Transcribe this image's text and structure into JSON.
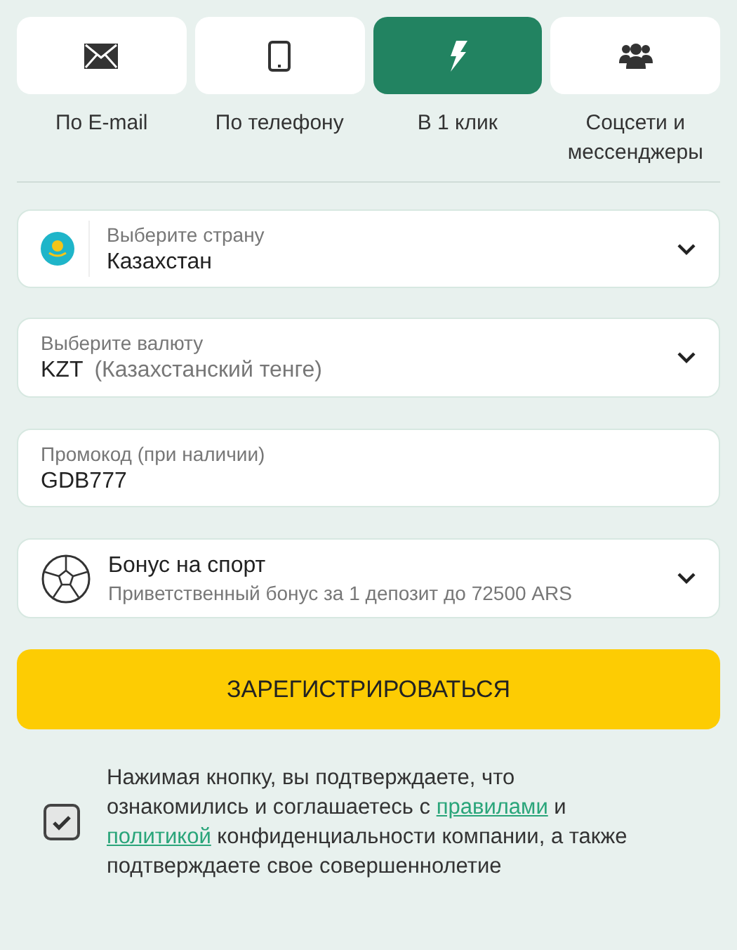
{
  "tabs": [
    {
      "kind": "email",
      "label": "По E-mail",
      "selected": false
    },
    {
      "kind": "phone",
      "label": "По телефону",
      "selected": false
    },
    {
      "kind": "oneclick",
      "label": "В 1 клик",
      "selected": true
    },
    {
      "kind": "social",
      "label": "Соцсети и мессенджеры",
      "selected": false
    }
  ],
  "country": {
    "label": "Выберите страну",
    "value": "Казахстан"
  },
  "currency": {
    "label": "Выберите валюту",
    "code": "KZT",
    "name": "(Казахстанский тенге)"
  },
  "promo": {
    "label": "Промокод (при наличии)",
    "value": "GDB777"
  },
  "bonus": {
    "title": "Бонус на спорт",
    "subtitle": "Приветственный бонус за 1 депозит до 72500 ARS"
  },
  "submit": "ЗАРЕГИСТРИРОВАТЬСЯ",
  "consent": {
    "checked": true,
    "parts": [
      {
        "kind": "text",
        "text": "Нажимая кнопку, вы подтверждаете, что ознакомились и соглашаетесь с "
      },
      {
        "kind": "link",
        "text": "правилами"
      },
      {
        "kind": "text",
        "text": " и "
      },
      {
        "kind": "link",
        "text": "политикой"
      },
      {
        "kind": "text",
        "text": " конфиденциальности компании, а также подтверждаете свое совершеннолетие"
      }
    ]
  }
}
